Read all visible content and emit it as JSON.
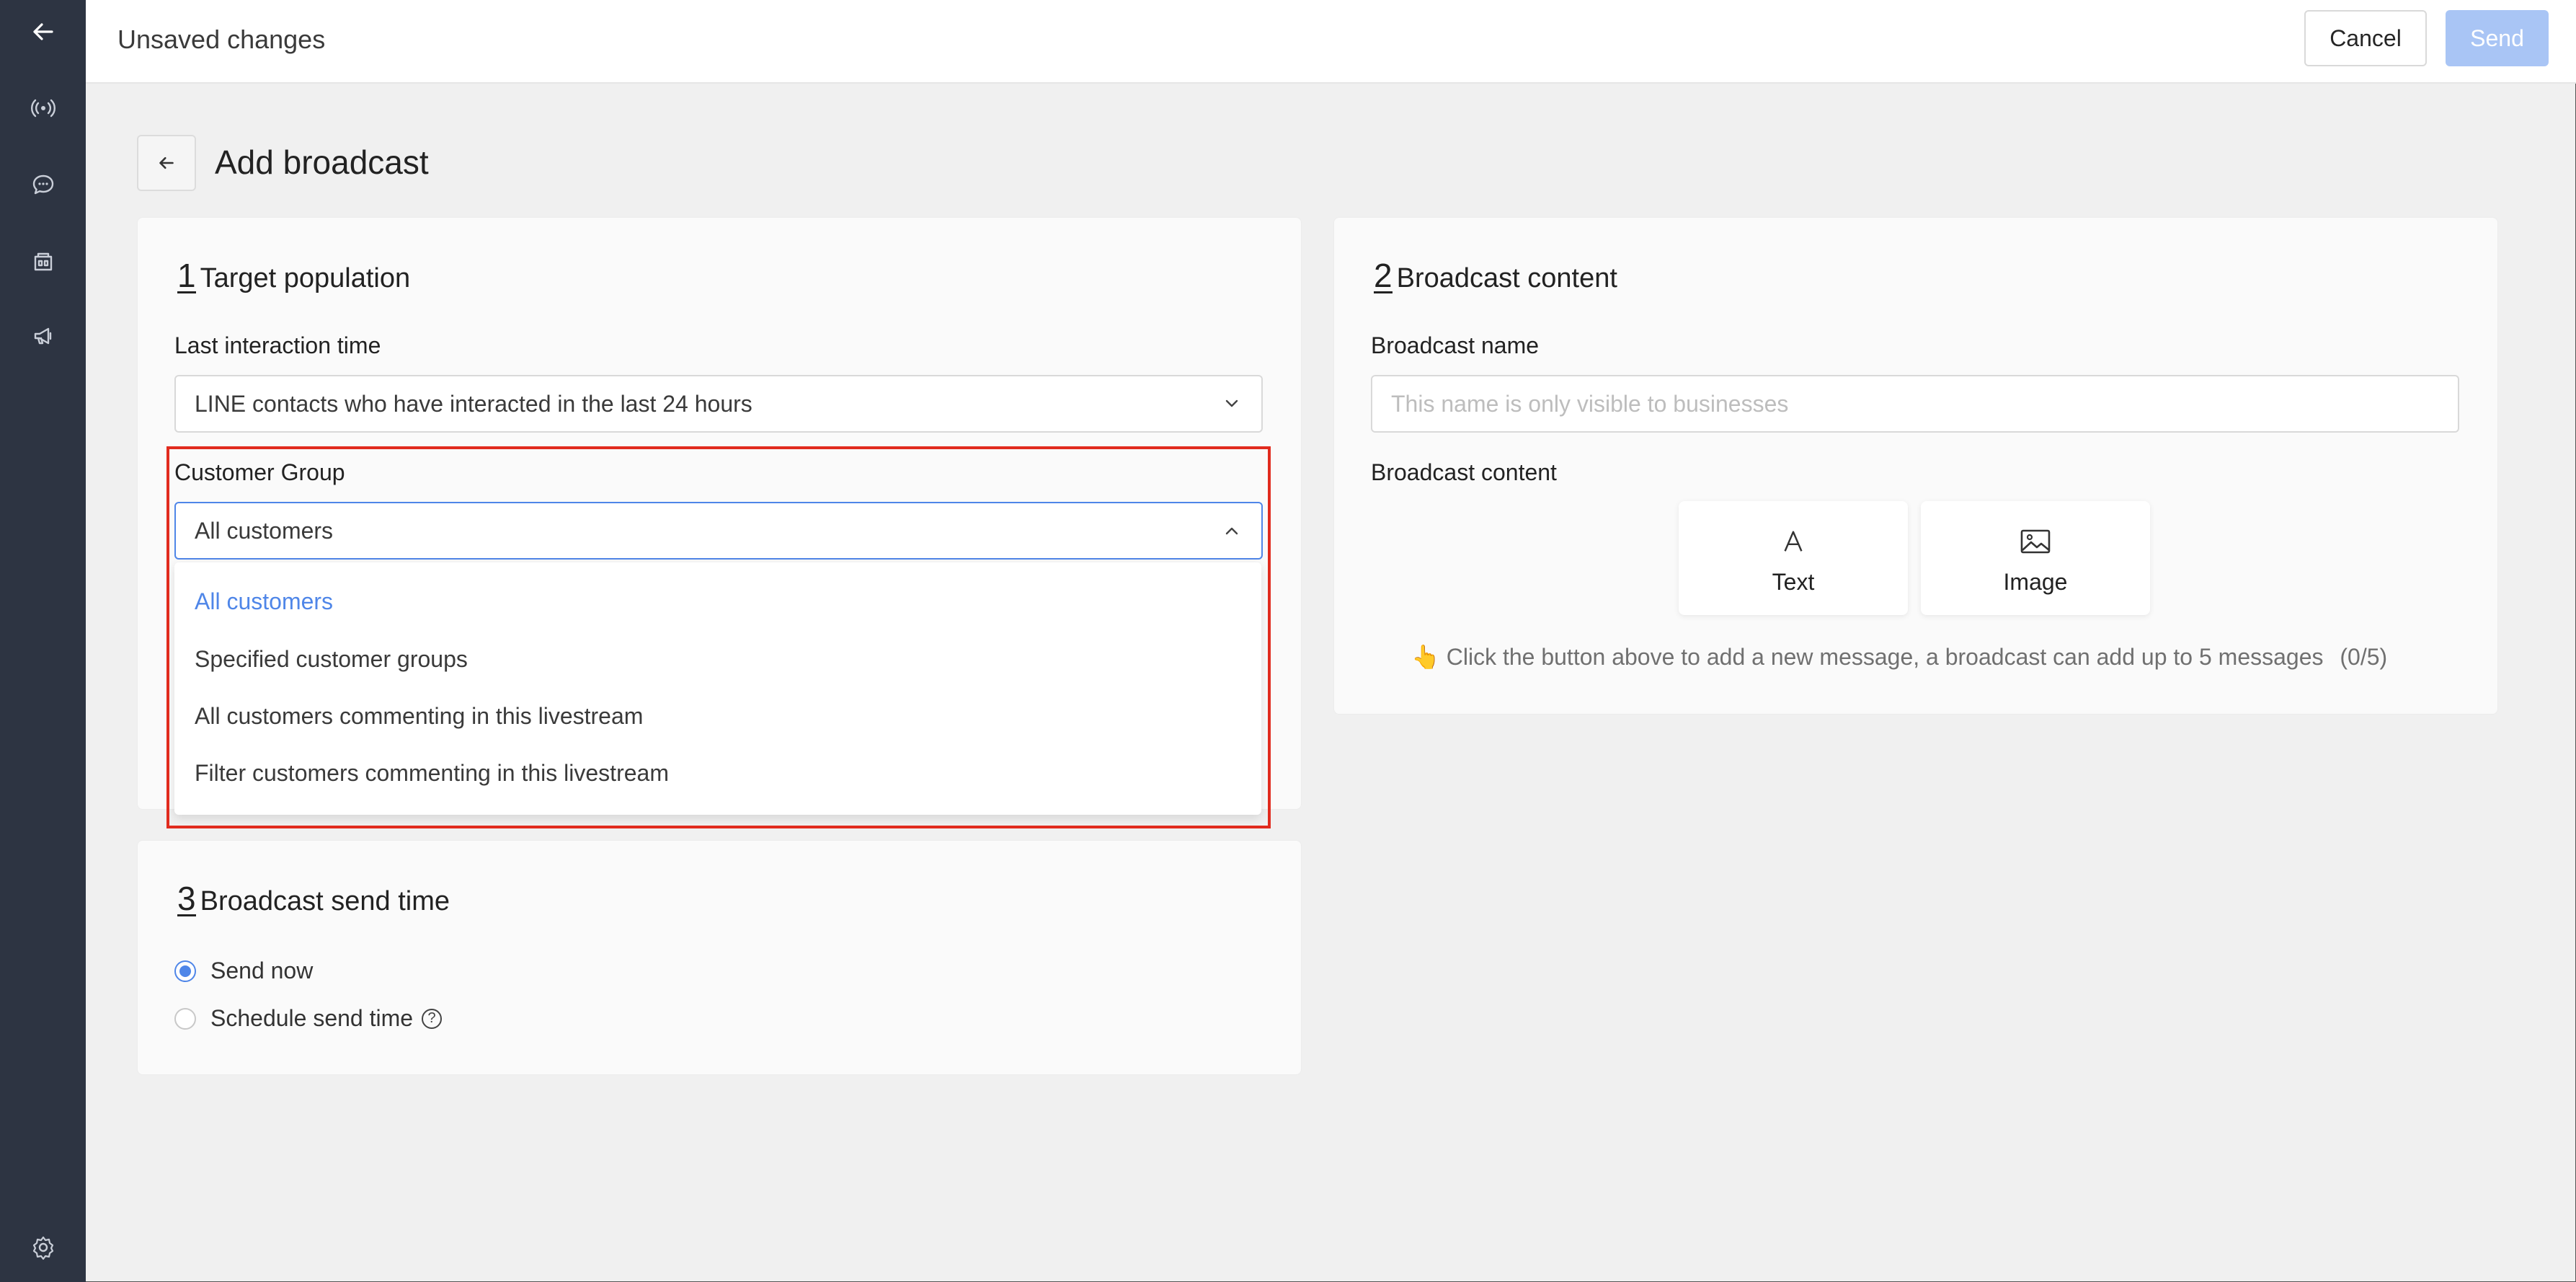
{
  "topbar": {
    "title": "Unsaved changes",
    "cancel_label": "Cancel",
    "send_label": "Send"
  },
  "page": {
    "title": "Add broadcast"
  },
  "sidebar": {
    "icons": [
      "back-arrow-icon",
      "broadcast-icon",
      "chat-icon",
      "store-icon",
      "megaphone-icon",
      "settings-icon"
    ]
  },
  "target": {
    "number": "1",
    "title": "Target population",
    "last_interaction_label": "Last interaction time",
    "last_interaction_value": "LINE contacts who have interacted in the last 24 hours",
    "customer_group_label": "Customer Group",
    "customer_group_value": "All customers",
    "options": [
      "All customers",
      "Specified customer groups",
      "All customers commenting in this livestream",
      "Filter customers commenting in this livestream"
    ]
  },
  "content": {
    "number": "2",
    "title": "Broadcast content",
    "name_label": "Broadcast name",
    "name_placeholder": "This name is only visible to businesses",
    "content_label": "Broadcast content",
    "text_button": "Text",
    "image_button": "Image",
    "hint": "👆 Click the button above to add a new message, a broadcast can add up to 5 messages",
    "count": "(0/5)"
  },
  "send_time": {
    "number": "3",
    "title": "Broadcast send time",
    "send_now": "Send now",
    "schedule": "Schedule send time"
  },
  "colors": {
    "accent": "#4f86e8",
    "highlight": "#e12b1e",
    "sidebar": "#2d3442"
  }
}
